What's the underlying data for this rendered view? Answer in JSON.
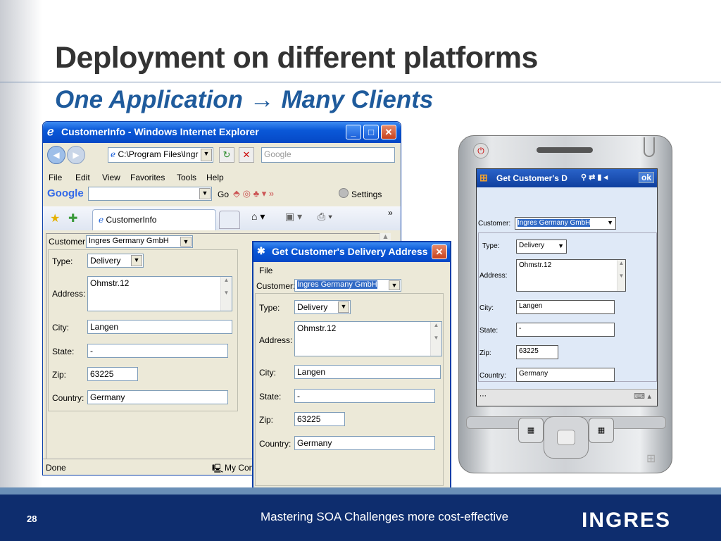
{
  "slide": {
    "title": "Deployment on different platforms",
    "subtitle": "One Application → Many Clients",
    "page_number": "28",
    "footer_text": "Mastering SOA Challenges more cost-effective",
    "logo_text": "INGRES"
  },
  "ie": {
    "window_title": "CustomerInfo - Windows Internet Explorer",
    "address": "C:\\Program Files\\Ingr",
    "search_placeholder": "Google",
    "menu": [
      "File",
      "Edit",
      "View",
      "Favorites",
      "Tools",
      "Help"
    ],
    "google_toolbar_go": "Go",
    "google_settings": "Settings",
    "tab_label": "CustomerInfo",
    "status_done": "Done",
    "status_zone": "My Com",
    "form": {
      "customer_label": "Customer:",
      "customer_value": "Ingres Germany GmbH",
      "type_label": "Type:",
      "type_value": "Delivery",
      "address_label": "Address:",
      "address_value": "Ohmstr.12",
      "city_label": "City:",
      "city_value": "Langen",
      "state_label": "State:",
      "state_value": "-",
      "zip_label": "Zip:",
      "zip_value": "63225",
      "country_label": "Country:",
      "country_value": "Germany"
    }
  },
  "dialog": {
    "window_title": "Get Customer's Delivery Address",
    "menu_file": "File",
    "form": {
      "customer_label": "Customer:",
      "customer_value": "Ingres Germany GmbH",
      "type_label": "Type:",
      "type_value": "Delivery",
      "address_label": "Address:",
      "address_value": "Ohmstr.12",
      "city_label": "City:",
      "city_value": "Langen",
      "state_label": "State:",
      "state_value": "-",
      "zip_label": "Zip:",
      "zip_value": "63225",
      "country_label": "Country:",
      "country_value": "Germany"
    }
  },
  "pda": {
    "app_title": "Get Customer's D",
    "ok_label": "ok",
    "form": {
      "customer_label": "Customer:",
      "customer_value": "Ingres Germany GmbH",
      "type_label": "Type:",
      "type_value": "Delivery",
      "address_label": "Address:",
      "address_value": "Ohmstr.12",
      "city_label": "City:",
      "city_value": "Langen",
      "state_label": "State:",
      "state_value": "-",
      "zip_label": "Zip:",
      "zip_value": "63225",
      "country_label": "Country:",
      "country_value": "Germany"
    }
  },
  "colors": {
    "title_text": "#333333",
    "subtitle_blue": "#1f5b9c",
    "footer_navy": "#0e2d6e",
    "xp_blue": "#0a58d8"
  }
}
